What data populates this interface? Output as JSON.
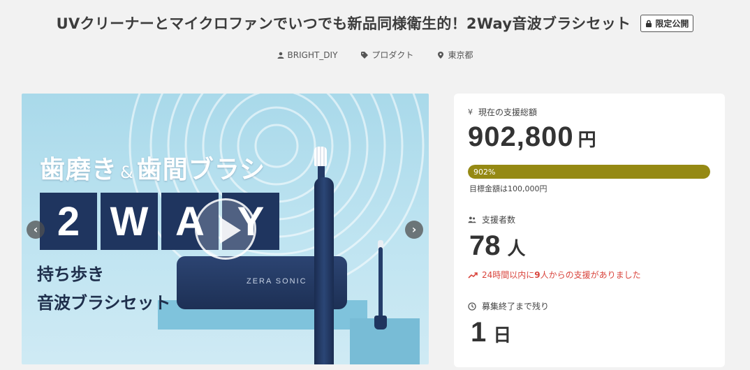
{
  "header": {
    "title": "UVクリーナーとマイクロファンでいつでも新品同様衛生的！2Way音波ブラシセット",
    "badge": "限定公開",
    "meta": [
      {
        "icon": "user-icon",
        "text": "BRIGHT_DIY"
      },
      {
        "icon": "tag-icon",
        "text": "プロダクト"
      },
      {
        "icon": "location-pin-icon",
        "text": "東京都"
      }
    ]
  },
  "hero": {
    "headline_part1": "歯磨き",
    "headline_amp": "&",
    "headline_part2": "歯間ブラシ",
    "tiles": [
      "2",
      "W",
      "A",
      "Y"
    ],
    "sub_line1": "持ち歩き",
    "sub_line2": "音波ブラシセット",
    "case_logo": "ZERA SONIC",
    "prev_icon": "chevron-left-icon",
    "next_icon": "chevron-right-icon",
    "play_icon": "play-icon"
  },
  "stats": {
    "total_label": "現在の支援総額",
    "total_icon": "yen-icon",
    "total_value": "902,800",
    "total_unit": "円",
    "progress_percent": 902,
    "progress_label": "902%",
    "goal_text": "目標金額は100,000円",
    "backers_label": "支援者数",
    "backers_icon": "users-icon",
    "backers_value": "78",
    "backers_unit": "人",
    "trend_icon": "trending-up-icon",
    "trend_text_prefix": "24時間以内に",
    "trend_number": "9",
    "trend_text_suffix": "人からの支援がありました",
    "days_label": "募集終了まで残り",
    "days_icon": "clock-icon",
    "days_value": "1",
    "days_unit": "日"
  },
  "colors": {
    "progress": "#958913",
    "trend": "#d9443c",
    "hero_navy": "#1f355f"
  }
}
